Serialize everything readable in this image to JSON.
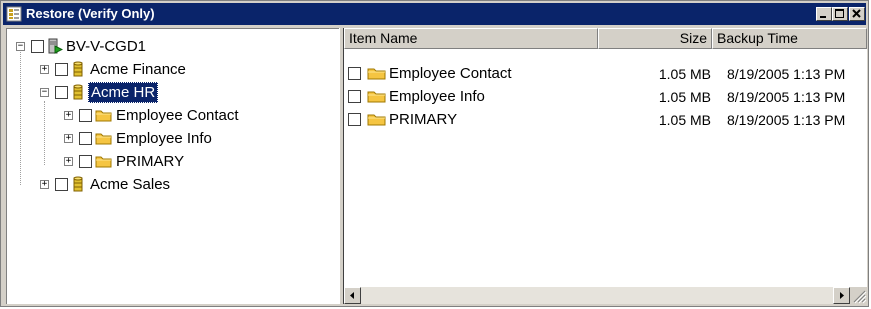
{
  "window": {
    "title": "Restore (Verify Only)",
    "controls": {
      "minimize": "minimize",
      "maximize": "maximize",
      "close": "close"
    }
  },
  "tree": {
    "root": {
      "label": "BV-V-CGD1",
      "expander": "−",
      "checked": false
    },
    "nodes": [
      {
        "label": "Acme Finance",
        "expander": "+",
        "checked": false,
        "icon": "database-icon"
      },
      {
        "label": "Acme HR",
        "expander": "−",
        "checked": false,
        "icon": "database-icon",
        "selected": true,
        "children": [
          {
            "label": "Employee Contact",
            "expander": "+",
            "checked": false,
            "icon": "folder-icon"
          },
          {
            "label": "Employee Info",
            "expander": "+",
            "checked": false,
            "icon": "folder-icon"
          },
          {
            "label": "PRIMARY",
            "expander": "+",
            "checked": false,
            "icon": "folder-icon"
          }
        ]
      },
      {
        "label": "Acme Sales",
        "expander": "+",
        "checked": false,
        "icon": "database-icon"
      }
    ]
  },
  "list": {
    "columns": {
      "name": "Item Name",
      "size": "Size",
      "time": "Backup Time"
    },
    "rows": [
      {
        "name": "Employee Contact",
        "size": "1.05 MB",
        "time": "8/19/2005 1:13 PM",
        "checked": false
      },
      {
        "name": "Employee Info",
        "size": "1.05 MB",
        "time": "8/19/2005 1:13 PM",
        "checked": false
      },
      {
        "name": "PRIMARY",
        "size": "1.05 MB",
        "time": "8/19/2005 1:13 PM",
        "checked": false
      }
    ]
  },
  "colors": {
    "titlebar": "#0a246a",
    "selection": "#0a246a",
    "folder": "#f5c542",
    "database": "#d8b020",
    "face": "#d4d0c8"
  }
}
